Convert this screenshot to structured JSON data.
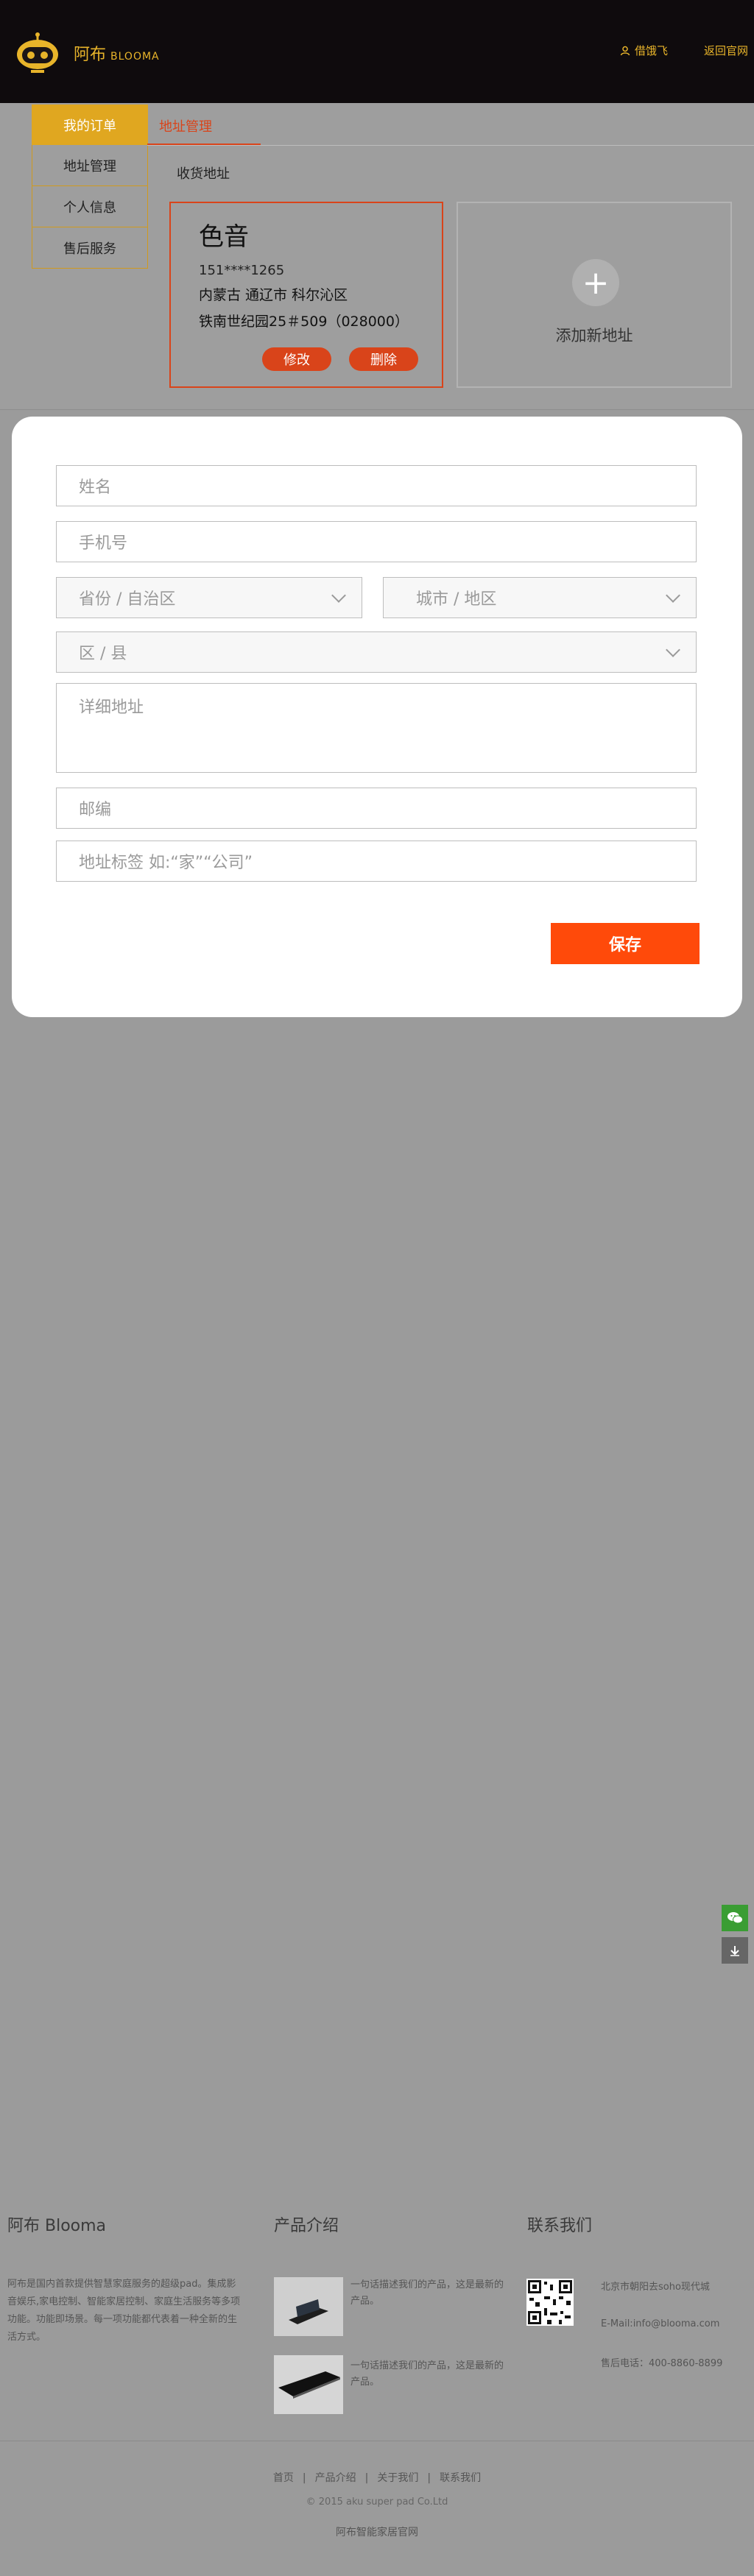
{
  "header": {
    "brand_cn": "阿布",
    "brand_en": "BLOOMA",
    "user_name": "借饿飞",
    "home_link": "返回官网"
  },
  "sidebar": {
    "title": "我的订单",
    "items": [
      {
        "label": "地址管理"
      },
      {
        "label": "个人信息"
      },
      {
        "label": "售后服务"
      }
    ]
  },
  "tabs": {
    "active": "地址管理"
  },
  "section_title": "收货地址",
  "address_card": {
    "name": "色音",
    "phone": "151****1265",
    "region": "内蒙古 通辽市 科尔沁区",
    "detail": "铁南世纪园25＃509（028000）",
    "edit_label": "修改",
    "delete_label": "删除"
  },
  "add_card": {
    "plus": "+",
    "label": "添加新地址"
  },
  "form": {
    "name_placeholder": "姓名",
    "phone_placeholder": "手机号",
    "province_placeholder": "省份 / 自治区",
    "city_placeholder": "城市 / 地区",
    "district_placeholder": "区 / 县",
    "detail_placeholder": "详细地址",
    "zip_placeholder": "邮编",
    "tag_placeholder": "地址标签 如:“家”“公司”",
    "save_label": "保存"
  },
  "footer": {
    "col1_title": "阿布 Blooma",
    "col1_desc": "阿布是国内首款提供智慧家庭服务的超级pad。集成影音娱乐,家电控制、智能家居控制、家庭生活服务等多项功能。功能即场景。每一项功能都代表着一种全新的生活方式。",
    "col2_title": "产品介绍",
    "products": [
      {
        "text": "一句话描述我们的产品，这是最新的产品。"
      },
      {
        "text": "一句话描述我们的产品，这是最新的产品。"
      }
    ],
    "col3_title": "联系我们",
    "address": "北京市朝阳去soho现代城",
    "email": "E-Mail:info@blooma.com",
    "phone": "售后电话：400-8860-8899",
    "links": [
      "首页",
      "产品介绍",
      "关于我们",
      "联系我们"
    ],
    "copyright": "© 2015 aku super pad Co.Ltd",
    "site": "阿布智能家居官网"
  },
  "colors": {
    "brand_gold": "#e8b42a",
    "accent_orange": "#d9441a",
    "save_orange": "#ff4a0a",
    "wechat_green": "#3a9d33"
  }
}
